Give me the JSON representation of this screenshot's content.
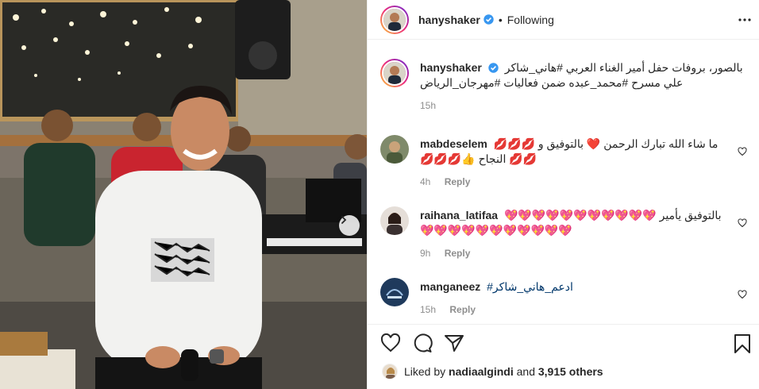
{
  "post": {
    "author": "hanyshaker",
    "follow_status": "Following",
    "separator": "•",
    "caption": "بالصور، بروفات حفل أمير الغناء العربي #هاني_شاكر علي مسرح #محمد_عبده ضمن فعاليات #مهرجان_الرياض",
    "caption_time": "15h"
  },
  "comments": [
    {
      "user": "mabdeselem",
      "text": "ما شاء الله تبارك الرحمن ❤️ بالتوفيق و 💋💋💋💋💋 النجاح 👍💋💋💋",
      "time": "4h",
      "reply_label": "Reply"
    },
    {
      "user": "raihana_latifaa",
      "text": "بالتوفيق يأمير 💖💖💖💖💖💖💖💖💖💖💖💖💖💖💖💖💖💖💖💖💖💖",
      "time": "9h",
      "reply_label": "Reply"
    },
    {
      "user": "manganeez",
      "text": "ادعم_هاني_شاكر#",
      "time": "15h",
      "reply_label": "Reply"
    }
  ],
  "likes": {
    "prefix": "Liked by",
    "first_user": "nadiaalgindi",
    "joiner": "and",
    "others": "3,915 others"
  },
  "icons": {
    "verified": "verified-badge-icon",
    "more": "more-options-icon",
    "like": "heart-icon",
    "comment": "comment-icon",
    "share": "share-icon",
    "save": "bookmark-icon",
    "next": "chevron-right-icon"
  },
  "colors": {
    "verified": "#3897f0",
    "text": "#262626",
    "muted": "#8e8e8e",
    "heart": "#ed4956"
  }
}
